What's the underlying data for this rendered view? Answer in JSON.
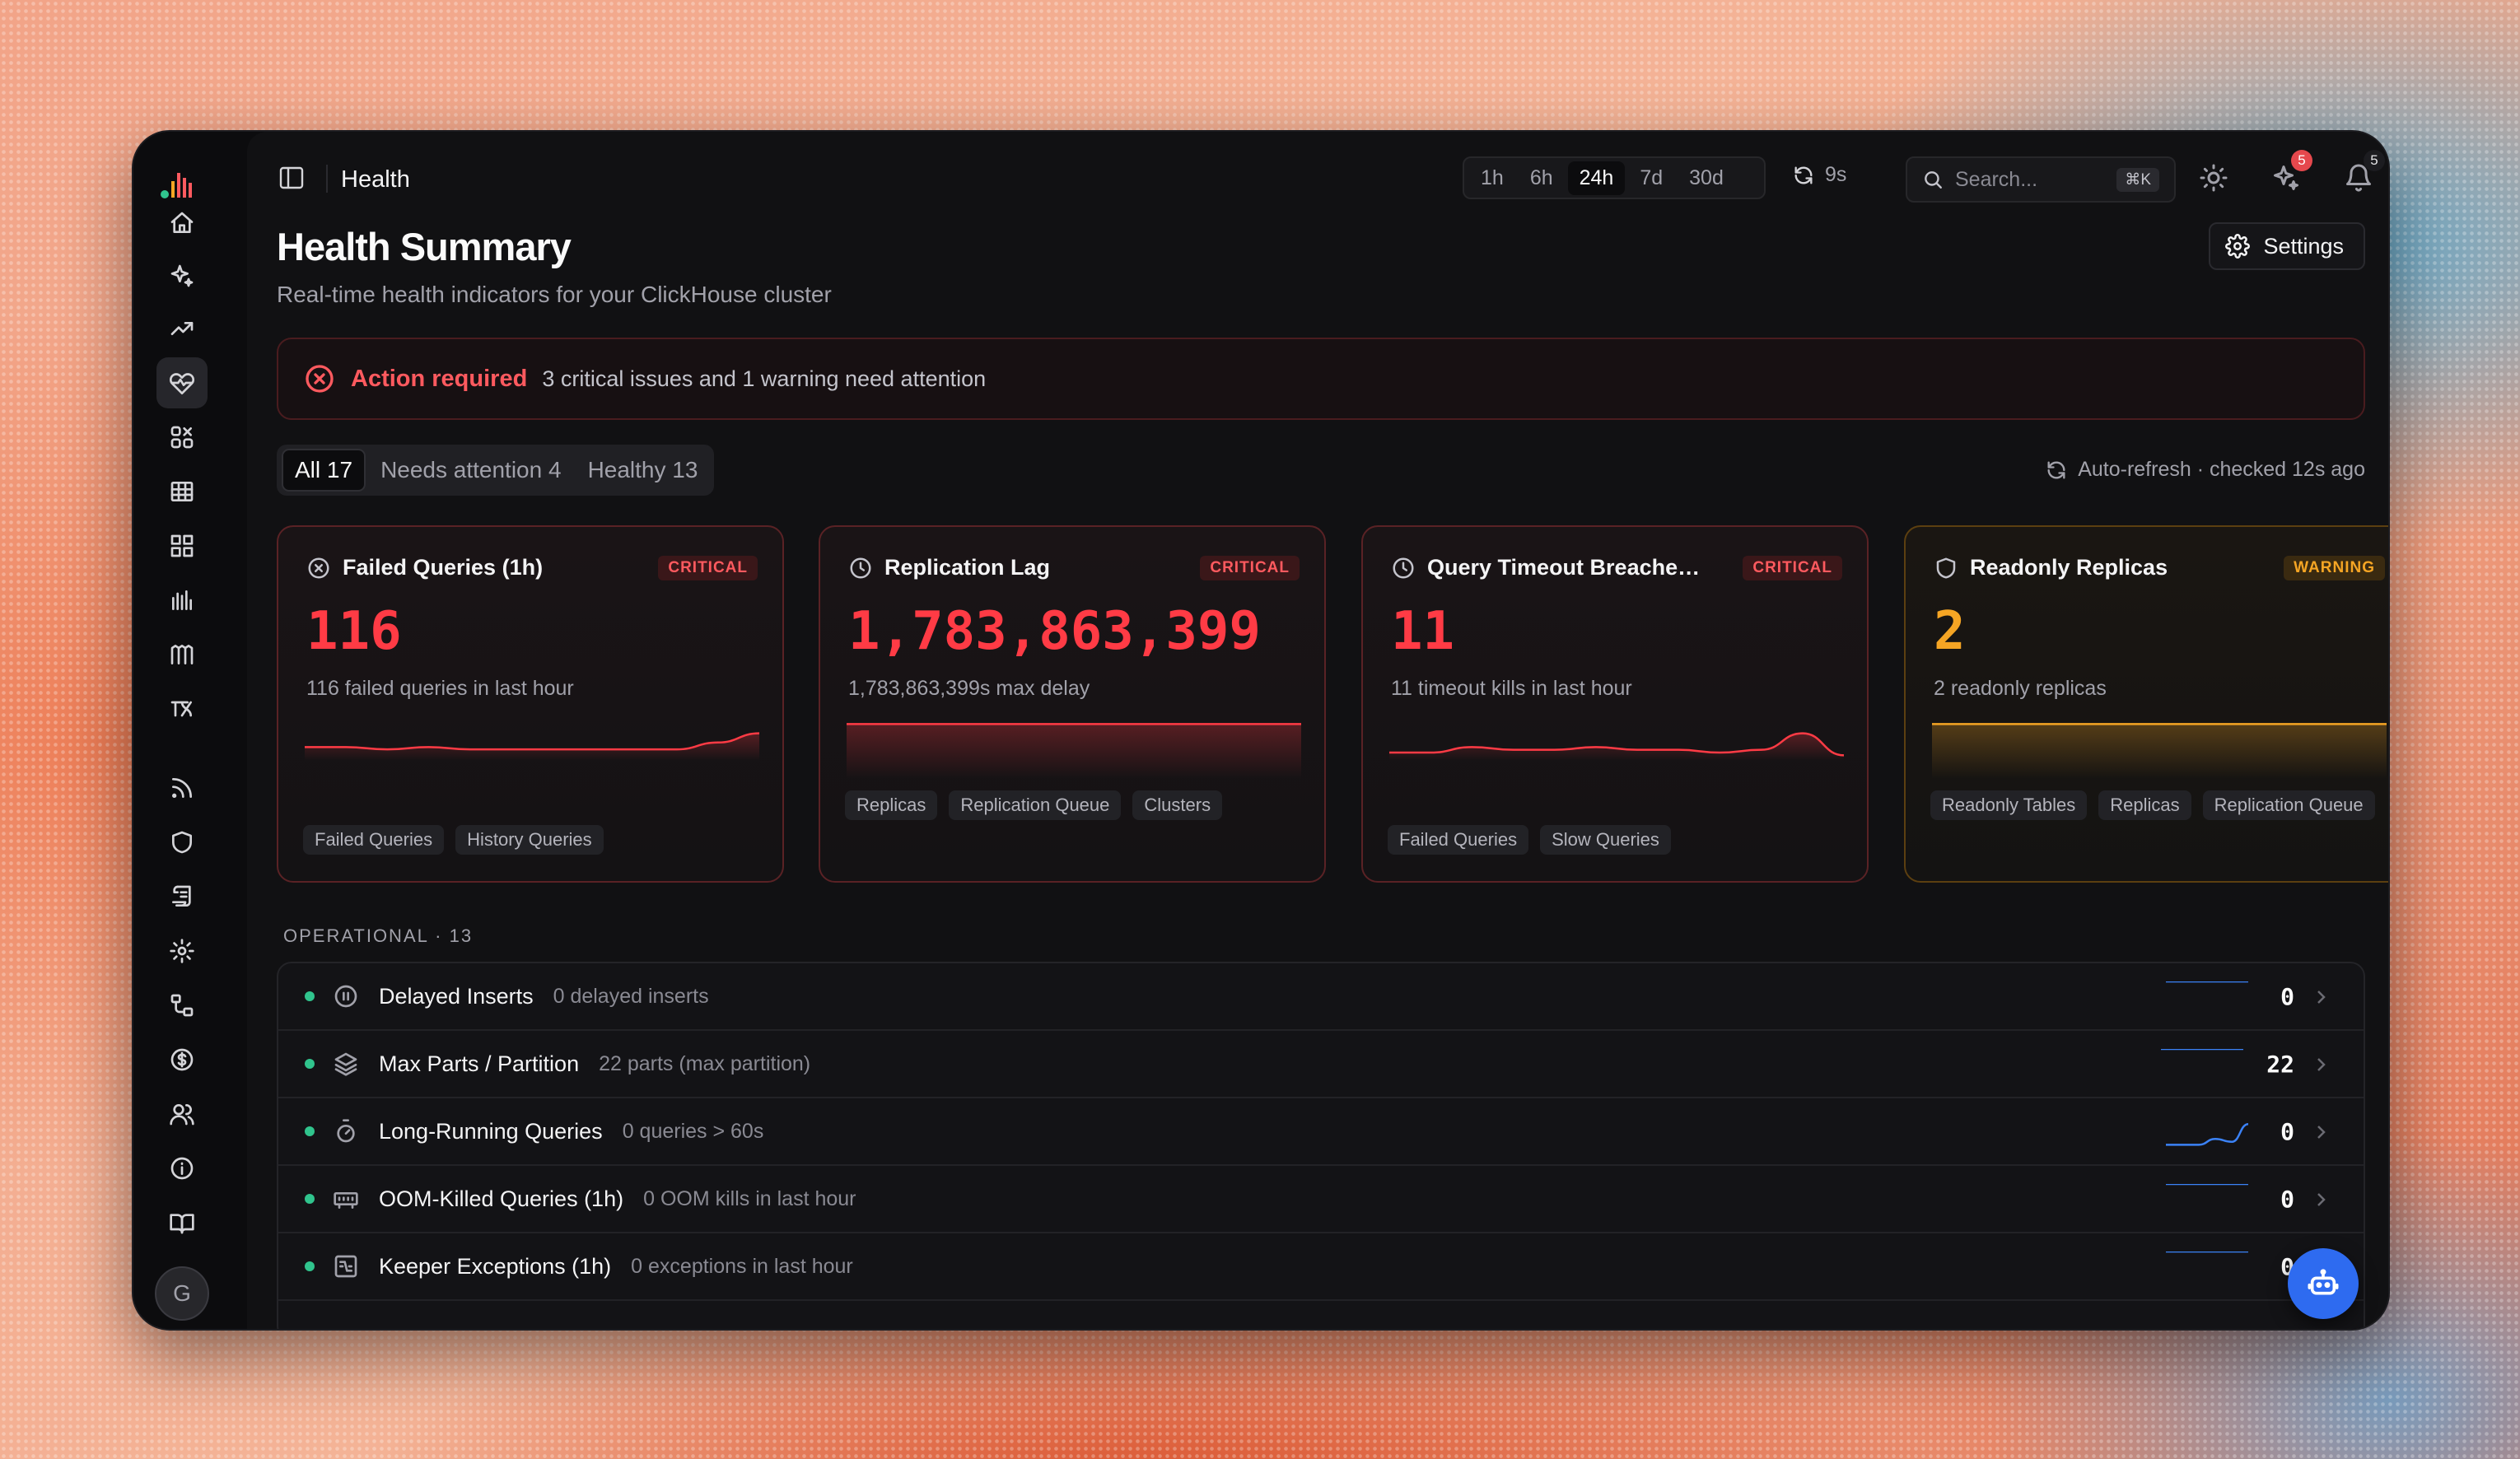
{
  "topbar": {
    "title": "Health",
    "ranges": [
      "1h",
      "6h",
      "24h",
      "7d",
      "30d"
    ],
    "active_range": "24h",
    "refresh_label": "9s",
    "search_placeholder": "Search...",
    "search_shortcut": "⌘K",
    "sparkle_badge": "5",
    "bell_badge": "5"
  },
  "header": {
    "title": "Health Summary",
    "subtitle": "Real-time health indicators for your ClickHouse cluster",
    "settings_label": "Settings"
  },
  "alert": {
    "title": "Action required",
    "text": "3 critical issues and 1 warning need attention"
  },
  "filters": [
    {
      "label": "All",
      "count": "17"
    },
    {
      "label": "Needs attention",
      "count": "4"
    },
    {
      "label": "Healthy",
      "count": "13"
    }
  ],
  "autorefresh": "Auto-refresh · checked 12s ago",
  "cards": [
    {
      "title": "Failed Queries (1h)",
      "status": "CRITICAL",
      "value": "116",
      "desc": "116 failed queries in last hour",
      "tags": [
        "Failed Queries",
        "History Queries"
      ],
      "trend": [
        6,
        6,
        5,
        6,
        5,
        5,
        5,
        5,
        5,
        5,
        8,
        12
      ],
      "icon": "x-circle-icon"
    },
    {
      "title": "Replication Lag",
      "status": "CRITICAL",
      "value": "1,783,863,399",
      "desc": "1,783,863,399s max delay",
      "tags": [
        "Replicas",
        "Replication Queue",
        "Clusters"
      ],
      "trend": [
        10,
        10,
        10,
        10,
        10,
        10,
        10,
        10,
        10,
        10,
        10,
        10
      ],
      "icon": "clock-icon"
    },
    {
      "title": "Query Timeout Breaches ...",
      "status": "CRITICAL",
      "value": "11",
      "desc": "11 timeout kills in last hour",
      "tags": [
        "Failed Queries",
        "Slow Queries"
      ],
      "trend": [
        3,
        3,
        5,
        4,
        4,
        5,
        4,
        4,
        3,
        4,
        10,
        2
      ],
      "icon": "clock-icon"
    },
    {
      "title": "Readonly Replicas",
      "status": "WARNING",
      "value": "2",
      "desc": "2 readonly replicas",
      "tags": [
        "Readonly Tables",
        "Replicas",
        "Replication Queue"
      ],
      "trend": [
        10,
        10,
        10,
        10,
        10,
        10,
        10,
        10,
        10,
        10,
        10,
        10
      ],
      "icon": "shield-icon"
    }
  ],
  "operational": {
    "label": "OPERATIONAL",
    "count": "13",
    "rows": [
      {
        "name": "Delayed Inserts",
        "desc": "0 delayed inserts",
        "value": "0",
        "icon": "pause-circle-icon",
        "trend": [
          2,
          2,
          2,
          2,
          2,
          2
        ]
      },
      {
        "name": "Max Parts / Partition",
        "desc": "22 parts (max partition)",
        "value": "22",
        "icon": "layers-icon",
        "trend": [
          8,
          8,
          8,
          8,
          8,
          8
        ]
      },
      {
        "name": "Long-Running Queries",
        "desc": "0 queries > 60s",
        "value": "0",
        "icon": "timer-icon",
        "trend": [
          1,
          1,
          1,
          3,
          2,
          8
        ]
      },
      {
        "name": "OOM-Killed Queries (1h)",
        "desc": "0 OOM kills in last hour",
        "value": "0",
        "icon": "memory-icon",
        "trend": [
          1,
          1,
          1,
          1,
          1,
          1
        ]
      },
      {
        "name": "Keeper Exceptions (1h)",
        "desc": "0 exceptions in last hour",
        "value": "0",
        "icon": "keeper-icon",
        "trend": [
          1,
          1,
          1,
          1,
          1,
          1
        ]
      }
    ]
  },
  "sidebar": {
    "avatar": "G",
    "items": [
      "home-icon",
      "sparkles-icon",
      "trend-icon",
      "heart-pulse-icon",
      "apps-icon",
      "table-icon",
      "grid-icon",
      "bars-icon",
      "merges-icon",
      "mutations-icon",
      "feed-icon",
      "shield-icon",
      "scroll-icon",
      "settings-icon",
      "flow-icon",
      "dollar-icon",
      "users-icon",
      "info-icon",
      "book-icon"
    ]
  },
  "colors": {
    "critical": "#ff3b45",
    "warning": "#f5a524",
    "healthy": "#30c48d",
    "accent": "#2e6bf0",
    "spark_op": "#3b82f6"
  }
}
